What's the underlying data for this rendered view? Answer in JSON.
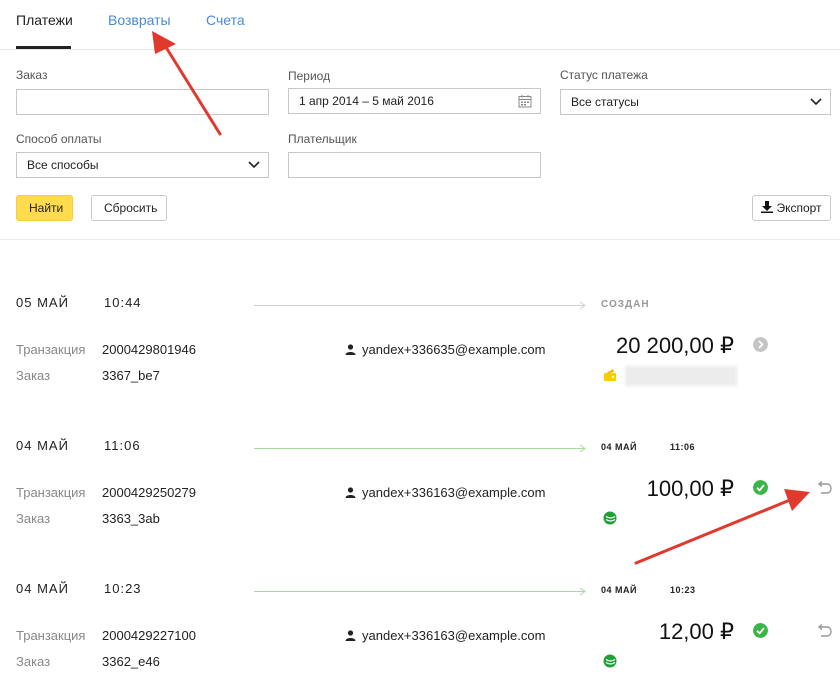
{
  "tabs": [
    {
      "label": "Платежи",
      "active": true
    },
    {
      "label": "Возвраты",
      "active": false
    },
    {
      "label": "Счета",
      "active": false
    }
  ],
  "filters": {
    "order": {
      "label": "Заказ",
      "value": ""
    },
    "period": {
      "label": "Период",
      "value": "1 апр 2014 – 5 май 2016"
    },
    "status": {
      "label": "Статус платежа",
      "value": "Все статусы"
    },
    "method": {
      "label": "Способ оплаты",
      "value": "Все способы"
    },
    "payer": {
      "label": "Плательщик",
      "value": ""
    }
  },
  "actions": {
    "find": "Найти",
    "reset": "Сбросить",
    "export": "Экспорт"
  },
  "labels": {
    "transaction": "Транзакция",
    "order": "Заказ"
  },
  "payments": [
    {
      "date": "05 МАЙ",
      "time": "10:44",
      "status_text": "СОЗДАН",
      "status_date": "",
      "status_time": "",
      "transaction": "2000429801946",
      "order": "3367_be7",
      "email": "yandex+336635@example.com",
      "amount": "20 200,00 ₽",
      "status": "pending",
      "method": "wallet-icon",
      "refundable": false
    },
    {
      "date": "04 МАЙ",
      "time": "11:06",
      "status_text": "",
      "status_date": "04 МАЙ",
      "status_time": "11:06",
      "transaction": "2000429250279",
      "order": "3363_3ab",
      "email": "yandex+336163@example.com",
      "amount": "100,00 ₽",
      "status": "success",
      "method": "sberbank-icon",
      "refundable": true
    },
    {
      "date": "04 МАЙ",
      "time": "10:23",
      "status_text": "",
      "status_date": "04 МАЙ",
      "status_time": "10:23",
      "transaction": "2000429227100",
      "order": "3362_e46",
      "email": "yandex+336163@example.com",
      "amount": "12,00 ₽",
      "status": "success",
      "method": "sberbank-icon",
      "refundable": true
    }
  ],
  "colors": {
    "accent": "#ffdb4d",
    "link": "#4a8ad6",
    "success": "#3bb54a",
    "pending": "#c4c4c4",
    "timeline_pending": "#cfcfcf",
    "timeline_done": "#a9d9a3",
    "annotation": "#e03a2e"
  }
}
